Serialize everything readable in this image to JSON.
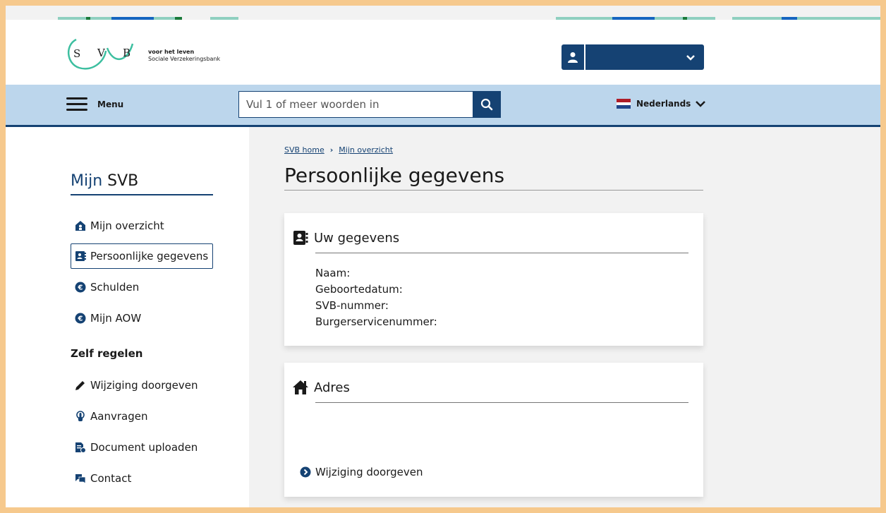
{
  "brand": {
    "logo_letters": [
      "S",
      "V",
      "B"
    ],
    "tagline_bold": "voor het leven",
    "tagline": "Sociale Verzekeringsbank",
    "primary_color": "#154273",
    "nav_bg_color": "#bcd6ec"
  },
  "header": {
    "user_icon": "user-icon",
    "user_dropdown_icon": "chevron-down-icon"
  },
  "navbar": {
    "menu_label": "Menu",
    "search_placeholder": "Vul 1 of meer woorden in",
    "search_icon": "search-icon",
    "language": "Nederlands",
    "language_icon": "flag-nl-icon"
  },
  "sidebar": {
    "title_prefix": "Mijn",
    "title_suffix": "SVB",
    "items": [
      {
        "label": "Mijn overzicht",
        "icon": "home-icon"
      },
      {
        "label": "Persoonlijke gegevens",
        "icon": "address-book-icon",
        "active": true
      },
      {
        "label": "Schulden",
        "icon": "euro-circle-icon"
      },
      {
        "label": "Mijn AOW",
        "icon": "euro-circle-icon"
      }
    ],
    "section_heading": "Zelf regelen",
    "actions": [
      {
        "label": "Wijziging doorgeven",
        "icon": "pencil-icon"
      },
      {
        "label": "Aanvragen",
        "icon": "hand-pointer-icon"
      },
      {
        "label": "Document uploaden",
        "icon": "document-upload-icon"
      },
      {
        "label": "Contact",
        "icon": "chat-icon"
      }
    ]
  },
  "main": {
    "breadcrumb": [
      "SVB home",
      "Mijn overzicht"
    ],
    "page_title": "Persoonlijke gegevens",
    "cards": [
      {
        "title": "Uw gegevens",
        "icon": "address-book-icon",
        "fields": [
          "Naam:",
          "Geboortedatum:",
          "SVB-nummer:",
          "Burgerservicenummer:"
        ]
      },
      {
        "title": "Adres",
        "icon": "home-icon",
        "link": "Wijziging doorgeven",
        "link_icon": "chevron-circle-right-icon"
      }
    ]
  }
}
